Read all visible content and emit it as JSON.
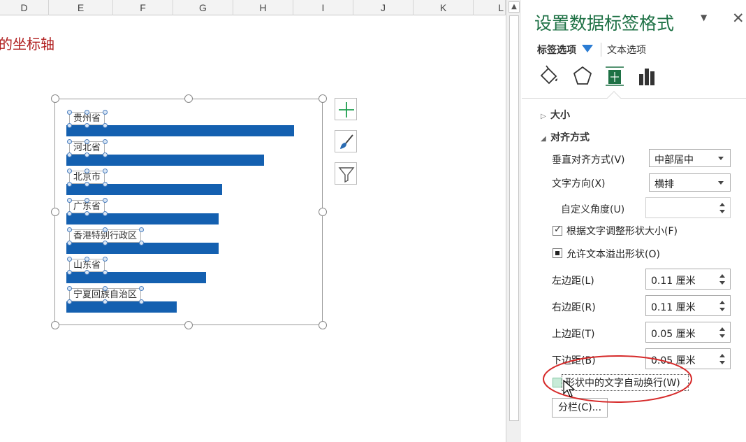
{
  "sheet": {
    "columns": [
      "D",
      "E",
      "F",
      "G",
      "H",
      "I",
      "J",
      "K",
      "L"
    ],
    "title_fragment": "的坐标轴"
  },
  "chart": {
    "data_labels": [
      "贵州省",
      "河北省",
      "北京市",
      "广东省",
      "香港特别行政区",
      "山东省",
      "宁夏回族自治区"
    ]
  },
  "chart_data": {
    "type": "bar",
    "orientation": "horizontal",
    "categories": [
      "贵州省",
      "河北省",
      "北京市",
      "广东省",
      "香港特别行政区",
      "山东省",
      "宁夏回族自治区"
    ],
    "values": [
      326,
      283,
      223,
      218,
      218,
      200,
      158
    ],
    "title": "",
    "xlabel": "",
    "ylabel": "",
    "grid": false,
    "legend": "none",
    "bar_color": "#1460B0"
  },
  "chart_buttons": [
    {
      "icon": "plus-icon",
      "color": "#1e9e4e"
    },
    {
      "icon": "brush-icon",
      "color": "#2b6cb3"
    },
    {
      "icon": "filter-icon",
      "color": "#555555"
    }
  ],
  "pane": {
    "title": "设置数据标签格式",
    "tabs": {
      "label_options": "标签选项",
      "text_options": "文本选项"
    },
    "icon_tabs": [
      "fill-line-icon",
      "effects-icon",
      "size-properties-icon",
      "label-options-icon"
    ],
    "sections": {
      "size": "大小",
      "alignment": "对齐方式"
    },
    "fields": {
      "vertical_align_label": "垂直对齐方式(V)",
      "vertical_align_value": "中部居中",
      "text_direction_label": "文字方向(X)",
      "text_direction_value": "横排",
      "custom_angle_label": "自定义角度(U)",
      "custom_angle_value": "",
      "resize_shape_label": "根据文字调整形状大小(F)",
      "resize_shape_checked": true,
      "overflow_label": "允许文本溢出形状(O)",
      "overflow_state": "partial",
      "left_margin_label": "左边距(L)",
      "left_margin_value": "0.11 厘米",
      "right_margin_label": "右边距(R)",
      "right_margin_value": "0.11 厘米",
      "top_margin_label": "上边距(T)",
      "top_margin_value": "0.05 厘米",
      "bottom_margin_label": "下边距(B)",
      "bottom_margin_value": "0.05 厘米",
      "wrap_text_label": "形状中的文字自动换行(W)",
      "wrap_text_checked": false,
      "columns_button": "分栏(C)..."
    },
    "colors": {
      "title": "#1E7145",
      "accent": "#2B7CD3",
      "annotation": "#D62A2A"
    }
  }
}
